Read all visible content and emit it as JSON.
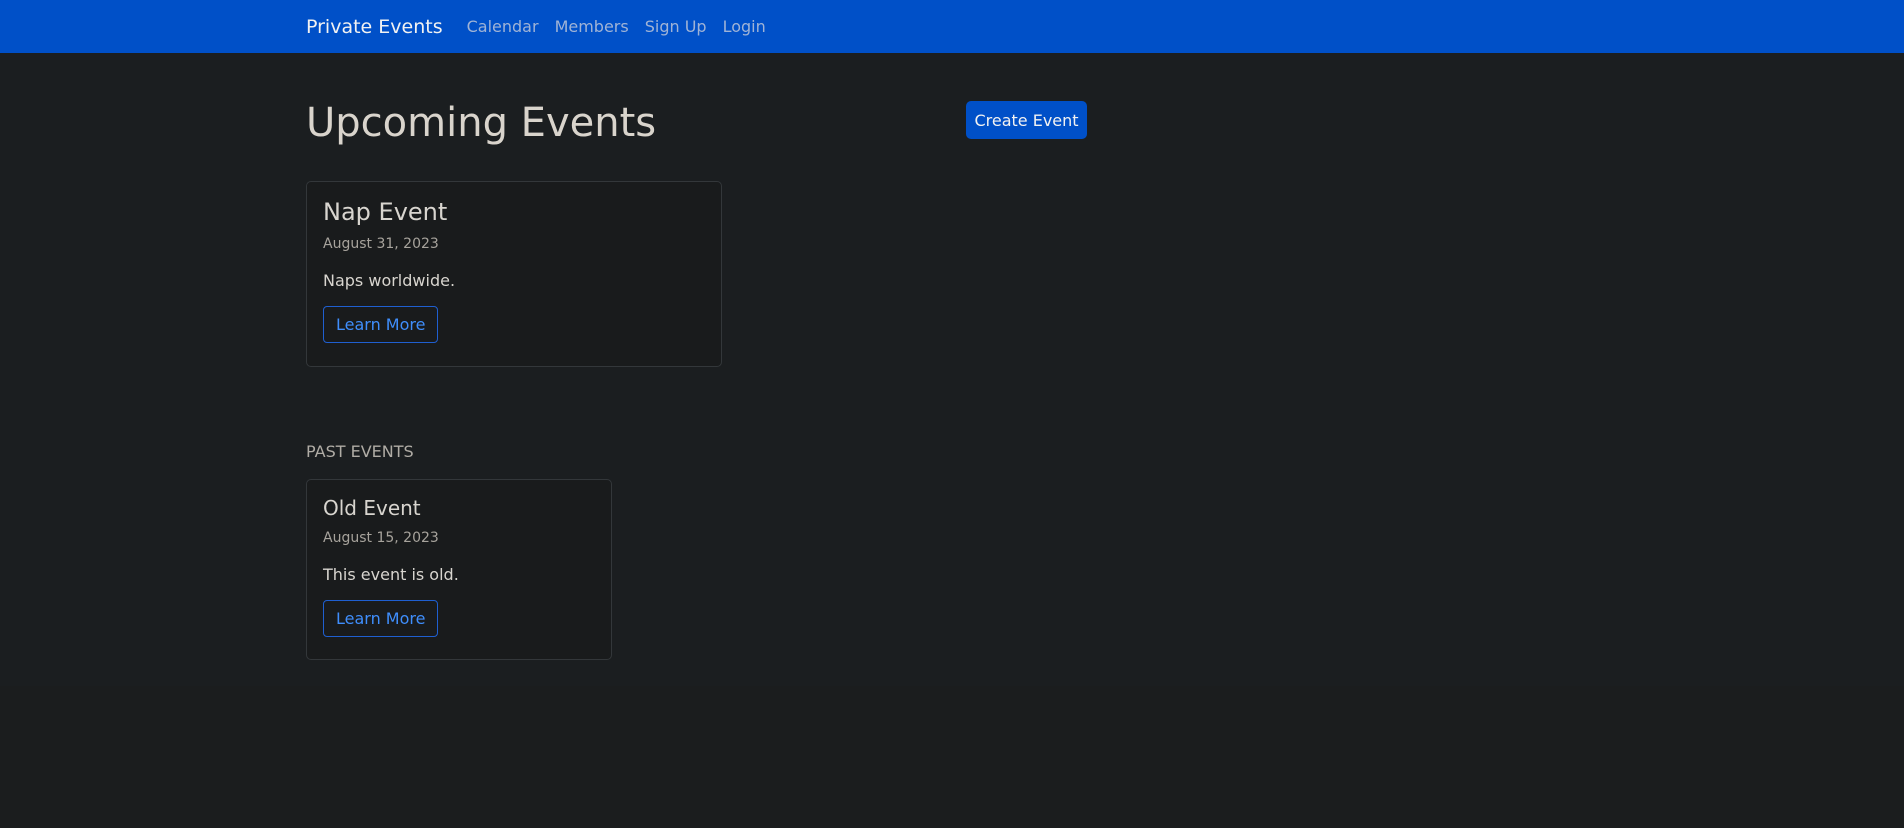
{
  "navbar": {
    "brand": "Private Events",
    "links": [
      {
        "label": "Calendar"
      },
      {
        "label": "Members"
      },
      {
        "label": "Sign Up"
      },
      {
        "label": "Login"
      }
    ]
  },
  "main": {
    "title": "Upcoming Events",
    "create_button": "Create Event",
    "upcoming": [
      {
        "title": "Nap Event",
        "date": "August 31, 2023",
        "description": "Naps worldwide.",
        "button": "Learn More"
      }
    ],
    "past_label": "PAST EVENTS",
    "past": [
      {
        "title": "Old Event",
        "date": "August 15, 2023",
        "description": "This event is old.",
        "button": "Learn More"
      }
    ]
  },
  "colors": {
    "navbar_bg": "#0050c8",
    "page_bg": "#1b1e20",
    "link_blue": "#3f8efc"
  }
}
